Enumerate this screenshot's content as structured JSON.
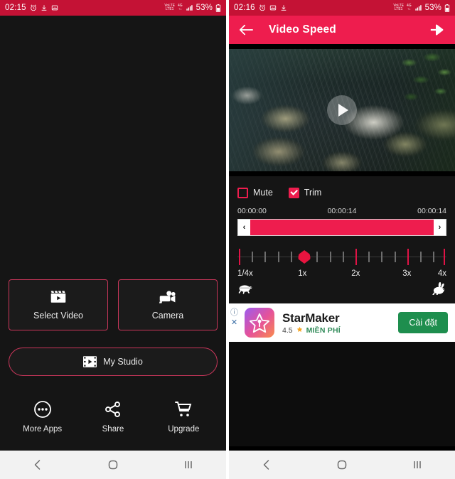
{
  "left_phone": {
    "status_bar": {
      "time": "02:15",
      "battery_percent": "53%",
      "network_label": "VoLTE",
      "network_type": "4G",
      "icons": [
        "alarm-icon",
        "screenshot-icon",
        "image-icon",
        "volte-icon",
        "signal-icon",
        "battery-icon"
      ]
    },
    "buttons": [
      {
        "label": "Select Video",
        "icon": "clapperboard-play-icon"
      },
      {
        "label": "Camera",
        "icon": "video-camera-icon"
      }
    ],
    "studio": {
      "label": "My Studio",
      "icon": "film-strip-play-icon"
    },
    "bottom_nav": [
      {
        "label": "More Apps",
        "icon": "more-dots-circle-icon"
      },
      {
        "label": "Share",
        "icon": "share-nodes-icon"
      },
      {
        "label": "Upgrade",
        "icon": "shopping-cart-icon"
      }
    ],
    "nav_bar": [
      "back-icon",
      "home-icon",
      "recents-icon"
    ]
  },
  "right_phone": {
    "status_bar": {
      "time": "02:16",
      "battery_percent": "53%",
      "network_label": "VoLTE",
      "network_type": "4G"
    },
    "app_bar": {
      "back_icon": "arrow-left-icon",
      "title": "Video Speed",
      "send_icon": "send-arrow-icon"
    },
    "video": {
      "play_icon": "play-icon",
      "description": "rocky stream video preview"
    },
    "options": [
      {
        "label": "Mute",
        "checked": false
      },
      {
        "label": "Trim",
        "checked": true
      }
    ],
    "timeline": {
      "start": "00:00:00",
      "current": "00:00:14",
      "end": "00:00:14",
      "left_handle_icon": "chevron-left-icon",
      "right_handle_icon": "chevron-right-icon",
      "left_handle_glyph": "‹",
      "right_handle_glyph": "›"
    },
    "speed": {
      "labels": [
        "1/4x",
        "1x",
        "2x",
        "3x",
        "4x"
      ],
      "selected": "1x",
      "slow_icon": "turtle-icon",
      "fast_icon": "rabbit-icon"
    },
    "ad": {
      "app_name": "StarMaker",
      "rating": "4.5",
      "price_label": "MIỀN PHÍ",
      "cta": "Cài đặt",
      "star_icon": "star-icon",
      "info_icon": "info-icon",
      "close_icon": "close-icon",
      "info_glyph": "ⓘ",
      "close_glyph": "✕"
    },
    "nav_bar": [
      "back-icon",
      "home-icon",
      "recents-icon"
    ]
  },
  "colors": {
    "status_bar_red": "#C41235",
    "app_bar_red": "#EE1D4E",
    "accent_red": "#E8143F",
    "outline_red": "#C8365A",
    "background_dark": "#151515",
    "nav_bar_gray": "#F2F2F2",
    "cta_green": "#1E8E4E"
  }
}
